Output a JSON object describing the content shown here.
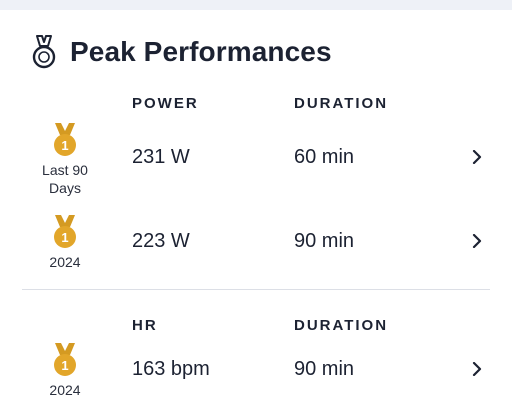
{
  "header": {
    "title": "Peak Performances",
    "icon": "medal-icon"
  },
  "power_section": {
    "labels": {
      "metric": "POWER",
      "duration": "DURATION"
    },
    "rows": [
      {
        "medal_rank": "1",
        "period": "Last 90 Days",
        "value": "231 W",
        "duration": "60 min"
      },
      {
        "medal_rank": "1",
        "period": "2024",
        "value": "223 W",
        "duration": "90 min"
      }
    ]
  },
  "hr_section": {
    "labels": {
      "metric": "HR",
      "duration": "DURATION"
    },
    "rows": [
      {
        "medal_rank": "1",
        "period": "2024",
        "value": "163 bpm",
        "duration": "90 min"
      }
    ]
  },
  "colors": {
    "gold": "#e2a62a",
    "ribbon": "#d49a22",
    "text": "#1c2232",
    "divider": "#dcdfe6"
  }
}
